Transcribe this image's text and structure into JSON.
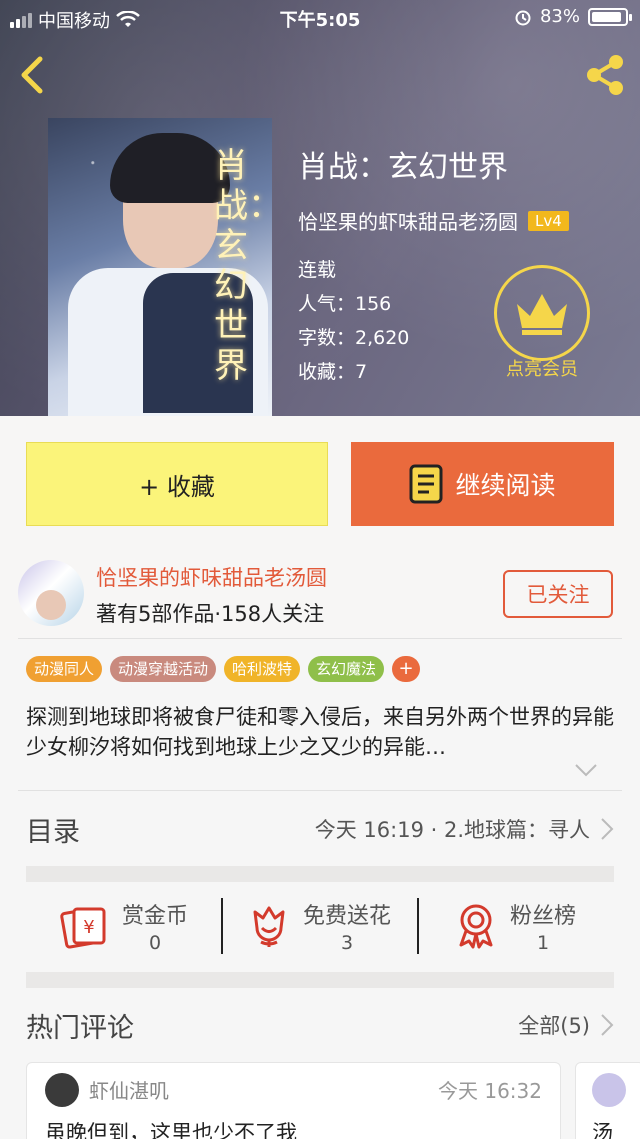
{
  "status_bar": {
    "carrier": "中国移动",
    "time": "下午5:05",
    "battery": "83%",
    "battery_level": 0.83
  },
  "book": {
    "title": "肖战：玄幻世界",
    "cover_title": "肖战：玄幻世界",
    "author": "恰坚果的虾味甜品老汤圆",
    "level": "Lv4",
    "status": "连载",
    "popularity": "人气：156",
    "word_count": "字数：2,620",
    "favorites": "收藏：7"
  },
  "vip": {
    "label": "点亮会员"
  },
  "actions": {
    "collect_label": "+ 收藏",
    "read_label": "继续阅读"
  },
  "author_section": {
    "name": "恰坚果的虾味甜品老汤圆",
    "stats": "著有5部作品·158人关注",
    "follow_label": "已关注"
  },
  "tags": [
    {
      "label": "动漫同人",
      "color": "#f0a032"
    },
    {
      "label": "动漫穿越活动",
      "color": "#c98a7e"
    },
    {
      "label": "哈利波特",
      "color": "#f0b429"
    },
    {
      "label": "玄幻魔法",
      "color": "#8fbf4a"
    },
    {
      "label": "+",
      "color": "#ea6a3d"
    }
  ],
  "summary": "探测到地球即将被食尸徒和零入侵后，来自另外两个世界的异能少女柳汐将如何找到地球上少之又少的异能…",
  "toc": {
    "heading": "目录",
    "latest": "今天 16:19 · 2.地球篇：寻人"
  },
  "stats": [
    {
      "title": "赏金币",
      "value": "0",
      "icon": "coin-envelope-icon"
    },
    {
      "title": "免费送花",
      "value": "3",
      "icon": "flower-icon"
    },
    {
      "title": "粉丝榜",
      "value": "1",
      "icon": "ribbon-badge-icon"
    }
  ],
  "comments_section": {
    "heading": "热门评论",
    "all_label": "全部(5)",
    "items": [
      {
        "user": "虾仙湛叽",
        "time": "今天 16:32",
        "text": "虽晚但到，这里也少不了我"
      },
      {
        "user": "",
        "time": "",
        "text": "汤"
      }
    ]
  },
  "colors": {
    "accent_orange": "#ea6a3d",
    "accent_yellow": "#fbf47a",
    "vip_gold": "#f5d64a",
    "author_red": "#e25a3a"
  }
}
